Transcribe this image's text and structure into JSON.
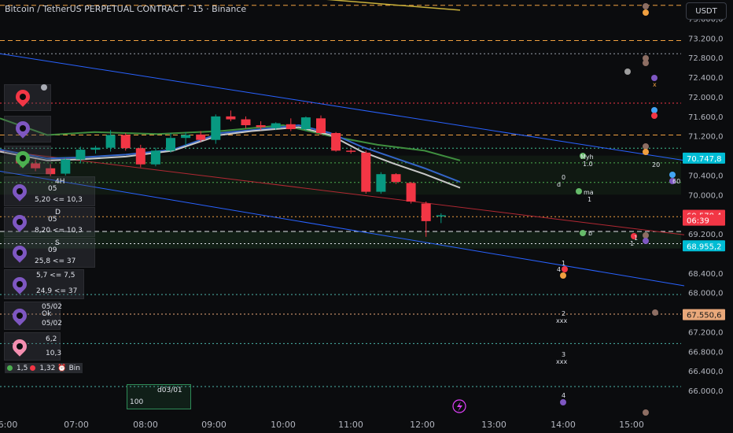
{
  "header": {
    "title": "Bitcoin / TetherUS PERPETUAL CONTRACT · 15 · Binance",
    "currency": "USDT"
  },
  "chart_data": {
    "type": "candlestick",
    "y_ticks": [
      "73.600,0",
      "73.200,0",
      "72.800,0",
      "72.400,0",
      "72.000,0",
      "71.600,0",
      "71.200,0",
      "70.400,0",
      "70.000,0",
      "69.200,0",
      "68.400,0",
      "68.000,0",
      "67.200,0",
      "66.800,0",
      "66.400,0",
      "66.000,0"
    ],
    "x_ticks": [
      "6:00",
      "07:00",
      "08:00",
      "09:00",
      "10:00",
      "11:00",
      "12:00",
      "13:00",
      "14:00",
      "15:00"
    ],
    "ylim": [
      65800,
      74000
    ],
    "candles": [
      {
        "o": 70720,
        "h": 70800,
        "l": 70560,
        "c": 70640
      },
      {
        "o": 70640,
        "h": 70720,
        "l": 70480,
        "c": 70540
      },
      {
        "o": 70540,
        "h": 70620,
        "l": 70380,
        "c": 70420
      },
      {
        "o": 70430,
        "h": 70760,
        "l": 70390,
        "c": 70720
      },
      {
        "o": 70720,
        "h": 70980,
        "l": 70640,
        "c": 70920
      },
      {
        "o": 70920,
        "h": 71000,
        "l": 70840,
        "c": 70960
      },
      {
        "o": 70960,
        "h": 71320,
        "l": 70880,
        "c": 71220
      },
      {
        "o": 71220,
        "h": 71260,
        "l": 70900,
        "c": 70950
      },
      {
        "o": 70950,
        "h": 71020,
        "l": 70560,
        "c": 70620
      },
      {
        "o": 70620,
        "h": 70960,
        "l": 70580,
        "c": 70900
      },
      {
        "o": 70900,
        "h": 71260,
        "l": 70860,
        "c": 71160
      },
      {
        "o": 71160,
        "h": 71280,
        "l": 71000,
        "c": 71220
      },
      {
        "o": 71230,
        "h": 71300,
        "l": 71080,
        "c": 71120
      },
      {
        "o": 71120,
        "h": 71640,
        "l": 71040,
        "c": 71600
      },
      {
        "o": 71600,
        "h": 71720,
        "l": 71500,
        "c": 71540
      },
      {
        "o": 71540,
        "h": 71600,
        "l": 71360,
        "c": 71420
      },
      {
        "o": 71420,
        "h": 71500,
        "l": 71320,
        "c": 71380
      },
      {
        "o": 71360,
        "h": 71480,
        "l": 71320,
        "c": 71460
      },
      {
        "o": 71440,
        "h": 71560,
        "l": 71300,
        "c": 71340
      },
      {
        "o": 71340,
        "h": 71600,
        "l": 71300,
        "c": 71580
      },
      {
        "o": 71560,
        "h": 71620,
        "l": 71220,
        "c": 71260
      },
      {
        "o": 71260,
        "h": 71280,
        "l": 70880,
        "c": 70900
      },
      {
        "o": 70900,
        "h": 70940,
        "l": 70840,
        "c": 70880
      },
      {
        "o": 70860,
        "h": 70900,
        "l": 70020,
        "c": 70060
      },
      {
        "o": 70060,
        "h": 70460,
        "l": 70020,
        "c": 70420
      },
      {
        "o": 70420,
        "h": 70440,
        "l": 70220,
        "c": 70260
      },
      {
        "o": 70240,
        "h": 70260,
        "l": 69820,
        "c": 69860
      },
      {
        "o": 69820,
        "h": 69860,
        "l": 69140,
        "c": 69460
      },
      {
        "o": 69580,
        "h": 69620,
        "l": 69420,
        "c": 69580
      }
    ],
    "price_tags": [
      {
        "label": "70.747,8",
        "color": "#00bcd4",
        "value": 70747.8
      },
      {
        "label": "69.578,4",
        "color": "#f23645",
        "value": 69578.4
      },
      {
        "label": "06:39",
        "color": "#f23645",
        "value": 69480
      },
      {
        "label": "68.955,2",
        "color": "#00bcd4",
        "value": 68955.2
      },
      {
        "label": "67.550,6",
        "color": "#e9a87a",
        "value": 67550.6
      }
    ],
    "hlines": [
      {
        "value": 73870,
        "color": "#f0a040",
        "dash": "6 4"
      },
      {
        "value": 73150,
        "color": "#f0a040",
        "dash": "6 4"
      },
      {
        "value": 72880,
        "color": "#9aa0aa",
        "dash": "2 3"
      },
      {
        "value": 71870,
        "color": "#f23645",
        "dash": "2 3"
      },
      {
        "value": 71220,
        "color": "#f0a040",
        "dash": "6 4"
      },
      {
        "value": 70950,
        "color": "#3fbf8f",
        "dash": "2 3"
      },
      {
        "value": 70650,
        "color": "#4caf50",
        "dash": "2 3"
      },
      {
        "value": 70250,
        "color": "#4caf50",
        "dash": "2 3"
      },
      {
        "value": 69550,
        "color": "#f0a040",
        "dash": "2 3"
      },
      {
        "value": 69250,
        "color": "#e0e3eb",
        "dash": "6 4"
      },
      {
        "value": 69000,
        "color": "#e0e3eb",
        "dash": "2 3"
      },
      {
        "value": 67960,
        "color": "#4db6ac",
        "dash": "2 3"
      },
      {
        "value": 67560,
        "color": "#e9a87a",
        "dash": "2 3"
      },
      {
        "value": 66960,
        "color": "#4db6ac",
        "dash": "2 3"
      },
      {
        "value": 66080,
        "color": "#4db6ac",
        "dash": "2 3"
      }
    ],
    "zones": [
      {
        "from": 70800,
        "to": 70000,
        "color": "rgba(76,175,80,0.08)"
      },
      {
        "from": 69250,
        "to": 68900,
        "color": "rgba(76,175,80,0.12)"
      }
    ]
  },
  "indicators": {
    "box1": {
      "tf": "4H",
      "count": "05",
      "val": "5,20 <= 10,3"
    },
    "box2": {
      "tf": "D",
      "count": "05",
      "val": "8,20 <= 10,3"
    },
    "box3": {
      "tf": "S",
      "count": "09",
      "val": "25,8 <= 37"
    },
    "box4": {
      "top": "5,7 <= 7,5",
      "bot": "24,9 <= 37"
    },
    "box5": {
      "top": "05/02",
      "mid": "Ok",
      "bot": "05/02"
    },
    "box6": {
      "top": "6,2",
      "bot": "10,3"
    },
    "legend": {
      "a": "1,5",
      "b": "1,32",
      "c": "Bin"
    },
    "green_box": {
      "label": "d03/01",
      "value": "100"
    }
  },
  "markers": [
    {
      "text": "Myh"
    },
    {
      "text": "1.0"
    },
    {
      "text": "ma"
    },
    {
      "text": "1"
    },
    {
      "text": "b"
    },
    {
      "text": "1"
    },
    {
      "text": "0"
    },
    {
      "text": "d"
    },
    {
      "text": "1"
    },
    {
      "text": "4"
    },
    {
      "text": "2"
    },
    {
      "text": "xxx"
    },
    {
      "text": "3"
    },
    {
      "text": "xxx"
    },
    {
      "text": "4"
    },
    {
      "text": "20"
    },
    {
      "text": "60"
    },
    {
      "text": "1"
    },
    {
      "text": "x"
    }
  ]
}
